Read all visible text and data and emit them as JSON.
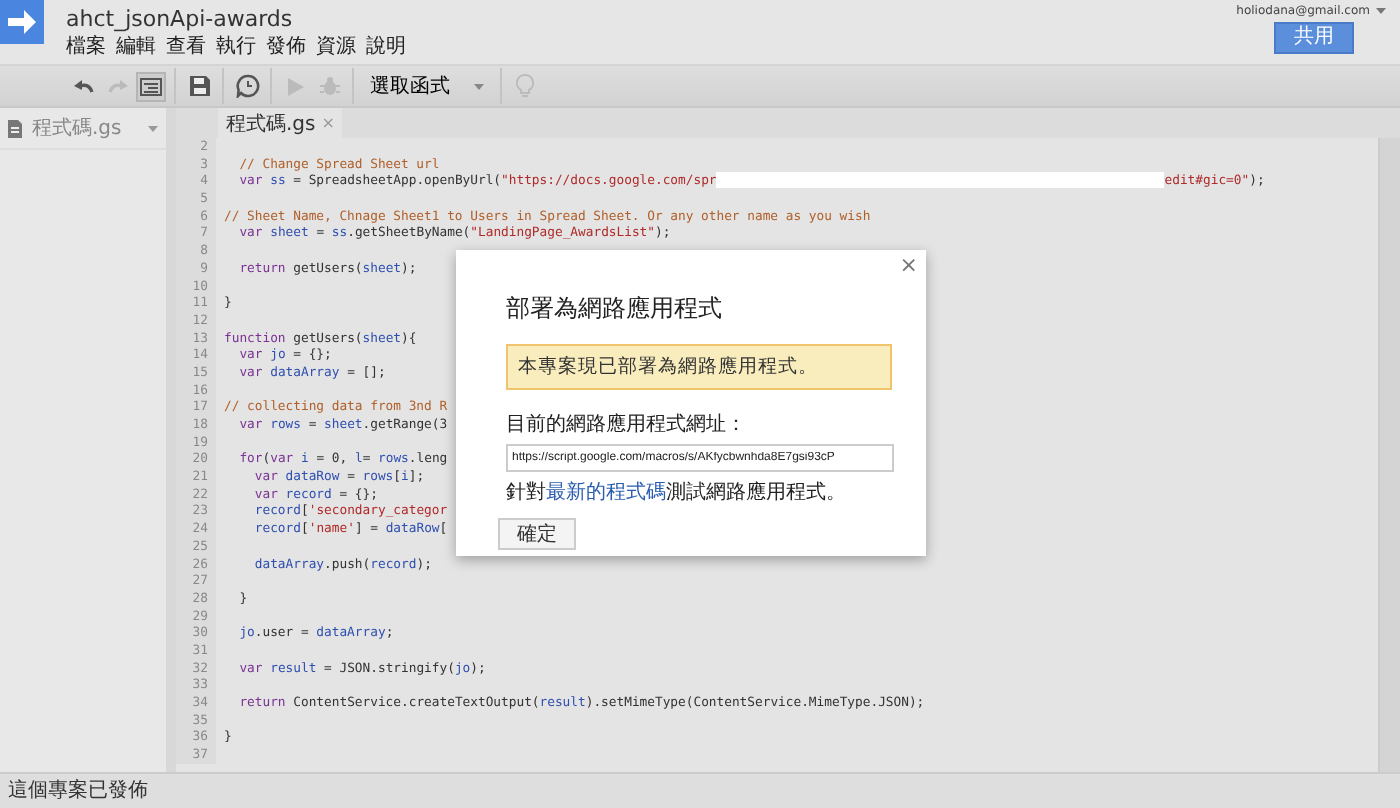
{
  "project_title": "ahct_jsonApi-awards",
  "menu": [
    "檔案",
    "編輯",
    "查看",
    "執行",
    "發佈",
    "資源",
    "說明"
  ],
  "account": {
    "email": "holiodana@gmail.com",
    "share_button": "共用"
  },
  "toolbar": {
    "groups": [
      [
        {
          "kind": "undo",
          "disabled": false,
          "on": false
        },
        {
          "kind": "redo",
          "disabled": true,
          "on": false
        },
        {
          "kind": "indent",
          "disabled": false,
          "on": true
        }
      ],
      [
        {
          "kind": "save",
          "disabled": false,
          "on": false
        }
      ],
      [
        {
          "kind": "history",
          "disabled": false,
          "on": false
        }
      ],
      [
        {
          "kind": "run",
          "disabled": true,
          "on": false
        },
        {
          "kind": "debug",
          "disabled": true,
          "on": false
        }
      ],
      [
        {
          "kind": "select",
          "label": "選取函式"
        }
      ],
      [
        {
          "kind": "hint",
          "disabled": true,
          "on": false
        }
      ]
    ]
  },
  "sidebar": {
    "files": [
      {
        "name": "程式碼.gs"
      }
    ]
  },
  "editor": {
    "tabs": [
      {
        "label": "程式碼.gs",
        "close": "×",
        "selected": true
      }
    ],
    "lines": [
      {
        "number": "2"
      },
      {
        "number": "3",
        "tokens": [
          {
            "kind": "comment",
            "text": "  // Change Spread Sheet url"
          }
        ]
      },
      {
        "number": "4",
        "tokens": [
          {
            "kind": "keyword",
            "text": "  var "
          },
          {
            "kind": "variable",
            "text": "ss"
          },
          {
            "kind": "plain",
            "text": " = SpreadsheetApp.openByUrl("
          },
          {
            "kind": "string",
            "text": "\"https://docs.google.com/spr"
          },
          {
            "kind": "redacted"
          },
          {
            "kind": "string",
            "text": "edit#gic=0\""
          },
          {
            "kind": "plain",
            "text": ");"
          }
        ]
      },
      {
        "number": "5"
      },
      {
        "number": "6",
        "tokens": [
          {
            "kind": "comment",
            "text": "// Sheet Name, Chnage Sheet1 to Users in Spread Sheet. Or any other name as you wish"
          }
        ]
      },
      {
        "number": "7",
        "tokens": [
          {
            "kind": "keyword",
            "text": "  var "
          },
          {
            "kind": "variable",
            "text": "sheet"
          },
          {
            "kind": "plain",
            "text": " = "
          },
          {
            "kind": "variable",
            "text": "ss"
          },
          {
            "kind": "plain",
            "text": ".getSheetByName("
          },
          {
            "kind": "string",
            "text": "\"LandingPage_AwardsList\""
          },
          {
            "kind": "plain",
            "text": ");"
          }
        ]
      },
      {
        "number": "8"
      },
      {
        "number": "9",
        "tokens": [
          {
            "kind": "keyword",
            "text": "  return "
          },
          {
            "kind": "plain",
            "text": "getUsers("
          },
          {
            "kind": "variable",
            "text": "sheet"
          },
          {
            "kind": "plain",
            "text": ");"
          }
        ]
      },
      {
        "number": "10"
      },
      {
        "number": "11",
        "tokens": [
          {
            "kind": "plain",
            "text": "}"
          }
        ]
      },
      {
        "number": "12"
      },
      {
        "number": "13",
        "tokens": [
          {
            "kind": "keyword",
            "text": "function "
          },
          {
            "kind": "plain",
            "text": "getUsers("
          },
          {
            "kind": "variable",
            "text": "sheet"
          },
          {
            "kind": "plain",
            "text": "){"
          }
        ]
      },
      {
        "number": "14",
        "tokens": [
          {
            "kind": "keyword",
            "text": "  var "
          },
          {
            "kind": "variable",
            "text": "jo"
          },
          {
            "kind": "plain",
            "text": " = {};"
          }
        ]
      },
      {
        "number": "15",
        "tokens": [
          {
            "kind": "keyword",
            "text": "  var "
          },
          {
            "kind": "variable",
            "text": "dataArray"
          },
          {
            "kind": "plain",
            "text": " = [];"
          }
        ]
      },
      {
        "number": "16"
      },
      {
        "number": "17",
        "tokens": [
          {
            "kind": "comment",
            "text": "// collecting data from 3nd R"
          }
        ]
      },
      {
        "number": "18",
        "tokens": [
          {
            "kind": "keyword",
            "text": "  var "
          },
          {
            "kind": "variable",
            "text": "rows"
          },
          {
            "kind": "plain",
            "text": " = "
          },
          {
            "kind": "variable",
            "text": "sheet"
          },
          {
            "kind": "plain",
            "text": ".getRange(3"
          }
        ]
      },
      {
        "number": "19"
      },
      {
        "number": "20",
        "tokens": [
          {
            "kind": "keyword",
            "text": "  for"
          },
          {
            "kind": "plain",
            "text": "("
          },
          {
            "kind": "keyword",
            "text": "var "
          },
          {
            "kind": "variable",
            "text": "i"
          },
          {
            "kind": "plain",
            "text": " = 0, "
          },
          {
            "kind": "variable",
            "text": "l"
          },
          {
            "kind": "plain",
            "text": "= "
          },
          {
            "kind": "variable",
            "text": "rows"
          },
          {
            "kind": "plain",
            "text": ".leng"
          }
        ]
      },
      {
        "number": "21",
        "tokens": [
          {
            "kind": "keyword",
            "text": "    var "
          },
          {
            "kind": "variable",
            "text": "dataRow"
          },
          {
            "kind": "plain",
            "text": " = "
          },
          {
            "kind": "variable",
            "text": "rows"
          },
          {
            "kind": "plain",
            "text": "["
          },
          {
            "kind": "variable",
            "text": "i"
          },
          {
            "kind": "plain",
            "text": "];"
          }
        ]
      },
      {
        "number": "22",
        "tokens": [
          {
            "kind": "keyword",
            "text": "    var "
          },
          {
            "kind": "variable",
            "text": "record"
          },
          {
            "kind": "plain",
            "text": " = {};"
          }
        ]
      },
      {
        "number": "23",
        "tokens": [
          {
            "kind": "variable",
            "text": "    record"
          },
          {
            "kind": "plain",
            "text": "["
          },
          {
            "kind": "string",
            "text": "'secondary_categor"
          }
        ]
      },
      {
        "number": "24",
        "tokens": [
          {
            "kind": "variable",
            "text": "    record"
          },
          {
            "kind": "plain",
            "text": "["
          },
          {
            "kind": "string",
            "text": "'name'"
          },
          {
            "kind": "plain",
            "text": "] = "
          },
          {
            "kind": "variable",
            "text": "dataRow"
          },
          {
            "kind": "plain",
            "text": "["
          }
        ]
      },
      {
        "number": "25"
      },
      {
        "number": "26",
        "tokens": [
          {
            "kind": "variable",
            "text": "    dataArray"
          },
          {
            "kind": "plain",
            "text": ".push("
          },
          {
            "kind": "variable",
            "text": "record"
          },
          {
            "kind": "plain",
            "text": ");"
          }
        ]
      },
      {
        "number": "27"
      },
      {
        "number": "28",
        "tokens": [
          {
            "kind": "plain",
            "text": "  }"
          }
        ]
      },
      {
        "number": "29"
      },
      {
        "number": "30",
        "tokens": [
          {
            "kind": "variable",
            "text": "  jo"
          },
          {
            "kind": "plain",
            "text": ".user = "
          },
          {
            "kind": "variable",
            "text": "dataArray"
          },
          {
            "kind": "plain",
            "text": ";"
          }
        ]
      },
      {
        "number": "31"
      },
      {
        "number": "32",
        "tokens": [
          {
            "kind": "keyword",
            "text": "  var "
          },
          {
            "kind": "variable",
            "text": "result"
          },
          {
            "kind": "plain",
            "text": " = JSON.stringify("
          },
          {
            "kind": "variable",
            "text": "jo"
          },
          {
            "kind": "plain",
            "text": ");"
          }
        ]
      },
      {
        "number": "33"
      },
      {
        "number": "34",
        "tokens": [
          {
            "kind": "keyword",
            "text": "  return "
          },
          {
            "kind": "plain",
            "text": "ContentService.createTextOutput("
          },
          {
            "kind": "variable",
            "text": "result"
          },
          {
            "kind": "plain",
            "text": ").setMimeType(ContentService.MimeType.JSON);"
          }
        ]
      },
      {
        "number": "35"
      },
      {
        "number": "36",
        "tokens": [
          {
            "kind": "plain",
            "text": "}"
          }
        ]
      },
      {
        "number": "37"
      }
    ]
  },
  "dialog": {
    "close": "×",
    "title": "部署為網路應用程式",
    "notice": "本專案現已部署為網路應用程式。",
    "url_label": "目前的網路應用程式網址：",
    "url_value": "https://script.google.com/macros/s/AKfycbwnhda8E7gsi93cP",
    "hint_before": "針對",
    "hint_link": "最新的程式碼",
    "hint_after": "測試網路應用程式。",
    "ok_button": "確定"
  },
  "status_bar": "這個專案已發佈"
}
